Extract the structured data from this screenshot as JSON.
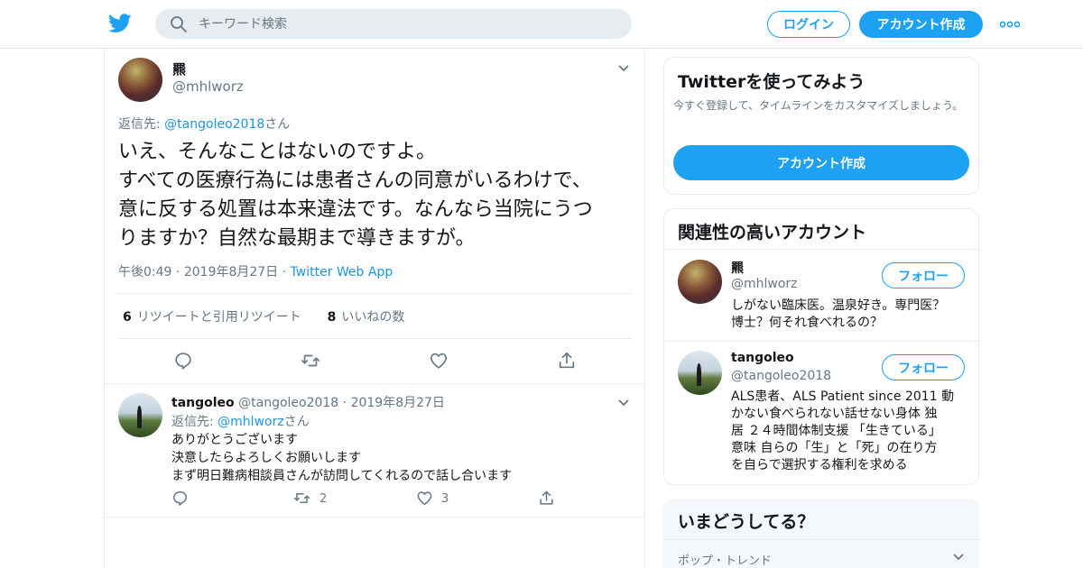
{
  "header": {
    "search_placeholder": "キーワード検索",
    "login_label": "ログイン",
    "signup_label": "アカウント作成"
  },
  "icons": {
    "logo": "twitter-bird-icon",
    "search": "search-icon",
    "more": "more-dots-icon",
    "caret": "chevron-down-icon",
    "reply": "reply-icon",
    "retweet": "retweet-icon",
    "like": "heart-icon",
    "share": "share-icon"
  },
  "colors": {
    "accent": "#1da1f2",
    "link": "#1b95e0",
    "muted": "#657786",
    "text": "#14171a",
    "border": "#e6ecf0"
  },
  "main_tweet": {
    "author_name": "羆",
    "author_handle": "@mhlworz",
    "reply_prefix": "返信先: ",
    "reply_to": "@tangoleo2018",
    "reply_suffix": "さん",
    "lines": [
      "いえ、そんなことはないのですよ。",
      "すべての医療行為には患者さんの同意がいるわけで、",
      "意に反する処置は本来違法です。なんなら当院にうつ",
      "りますか？自然な最期まで導きますが。"
    ],
    "time": "午後0:49",
    "date": "2019年8月27日",
    "via": "Twitter Web App",
    "retweet_count": "6",
    "retweet_label": "リツイートと引用リツイート",
    "like_count": "8",
    "like_label": "いいねの数"
  },
  "reply_tweet": {
    "author_name": "tangoleo",
    "author_handle": "@tangoleo2018",
    "date": "2019年8月27日",
    "reply_prefix": "返信先: ",
    "reply_to": "@mhlworz",
    "reply_suffix": "さん",
    "lines": [
      "ありがとうございます",
      "決意したらよろしくお願いします",
      "まず明日難病相談員さんが訪問してくれるので話し合います"
    ],
    "retweet_count": "2",
    "like_count": "3"
  },
  "sidebar": {
    "signup_card": {
      "title": "Twitterを使ってみよう",
      "subtitle": "今すぐ登録して、タイムラインをカスタマイズしましょう。",
      "button": "アカウント作成"
    },
    "related": {
      "title": "関連性の高いアカウント",
      "follow_label": "フォロー",
      "accounts": [
        {
          "name": "羆",
          "handle": "@mhlworz",
          "bio": [
            "しがない臨床医。温泉好き。専門医？",
            "博士？何それ食べれるの？"
          ]
        },
        {
          "name": "tangoleo",
          "handle": "@tangoleo2018",
          "bio": [
            "ALS患者、ALS Patient since 2011 動",
            "かない食べられない話せない身体 独",
            "居 ２４時間体制支援 「生きている」",
            "意味 自らの「生」と「死」の在り方",
            "を自らで選択する権利を求める"
          ]
        }
      ]
    },
    "trends": {
      "title": "いまどうしてる？",
      "category": "ポップ・トレンド"
    }
  }
}
